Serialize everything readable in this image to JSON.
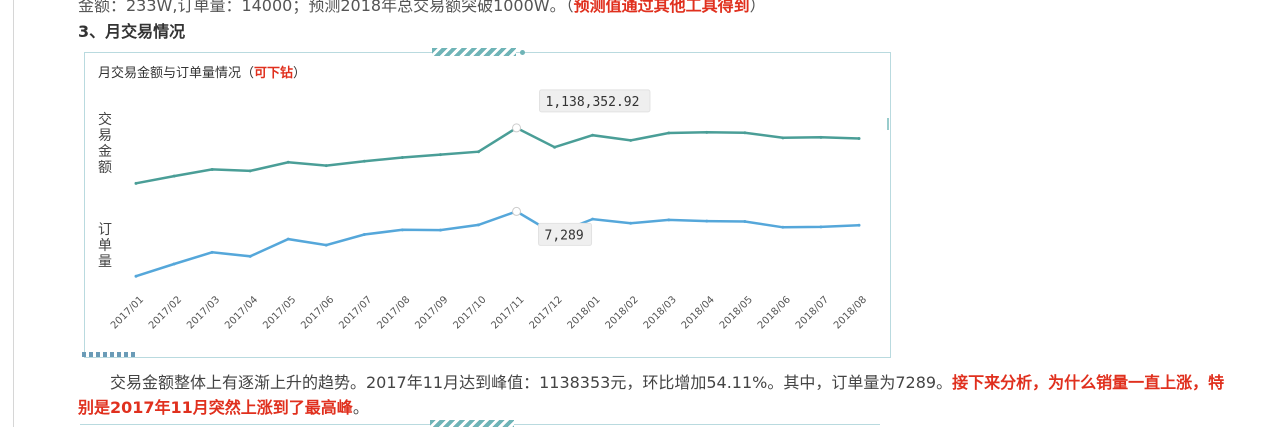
{
  "top_line": {
    "text": "金额：233W,订单量：14000；预测2018年总交易额突破1000W。（",
    "highlight": "预测值通过其他工具得到",
    "close": "）"
  },
  "section_heading": "3、月交易情况",
  "card": {
    "title": "月交易金额与订单量情况（",
    "title_highlight": "可下钻",
    "title_close": "）"
  },
  "chart_data": {
    "type": "line",
    "categories": [
      "2017/01",
      "2017/02",
      "2017/03",
      "2017/04",
      "2017/05",
      "2017/06",
      "2017/07",
      "2017/08",
      "2017/09",
      "2017/10",
      "2017/11",
      "2017/12",
      "2018/01",
      "2018/02",
      "2018/03",
      "2018/04",
      "2018/05",
      "2018/06",
      "2018/07",
      "2018/08"
    ],
    "series": [
      {
        "name": "交易金额",
        "color": "#4a9e97",
        "values": [
          560000,
          635000,
          705000,
          690000,
          780000,
          745000,
          790000,
          830000,
          860000,
          890000,
          1138352.92,
          937000,
          1062000,
          1008000,
          1085000,
          1092000,
          1088000,
          1035000,
          1040000,
          1028000
        ]
      },
      {
        "name": "订单量",
        "color": "#55a7da",
        "values": [
          2400,
          3320,
          4200,
          3900,
          5200,
          4750,
          5550,
          5900,
          5880,
          6270,
          7289,
          5580,
          6710,
          6400,
          6650,
          6560,
          6530,
          6090,
          6120,
          6250
        ]
      }
    ],
    "tooltips": [
      {
        "series": 0,
        "index": 10,
        "text": "1,138,352.92"
      },
      {
        "series": 1,
        "index": 10,
        "text": "7,289"
      }
    ],
    "grid": false,
    "legend": "none"
  },
  "paragraph": {
    "text": "交易金额整体上有逐渐上升的趋势。2017年11月达到峰值：1138353元，环比增加54.11%。其中，订单量为7289。",
    "highlight": "接下来分析，为什么销量一直上涨，特别是2017年11月突然上涨到了最高峰",
    "end": "。"
  }
}
